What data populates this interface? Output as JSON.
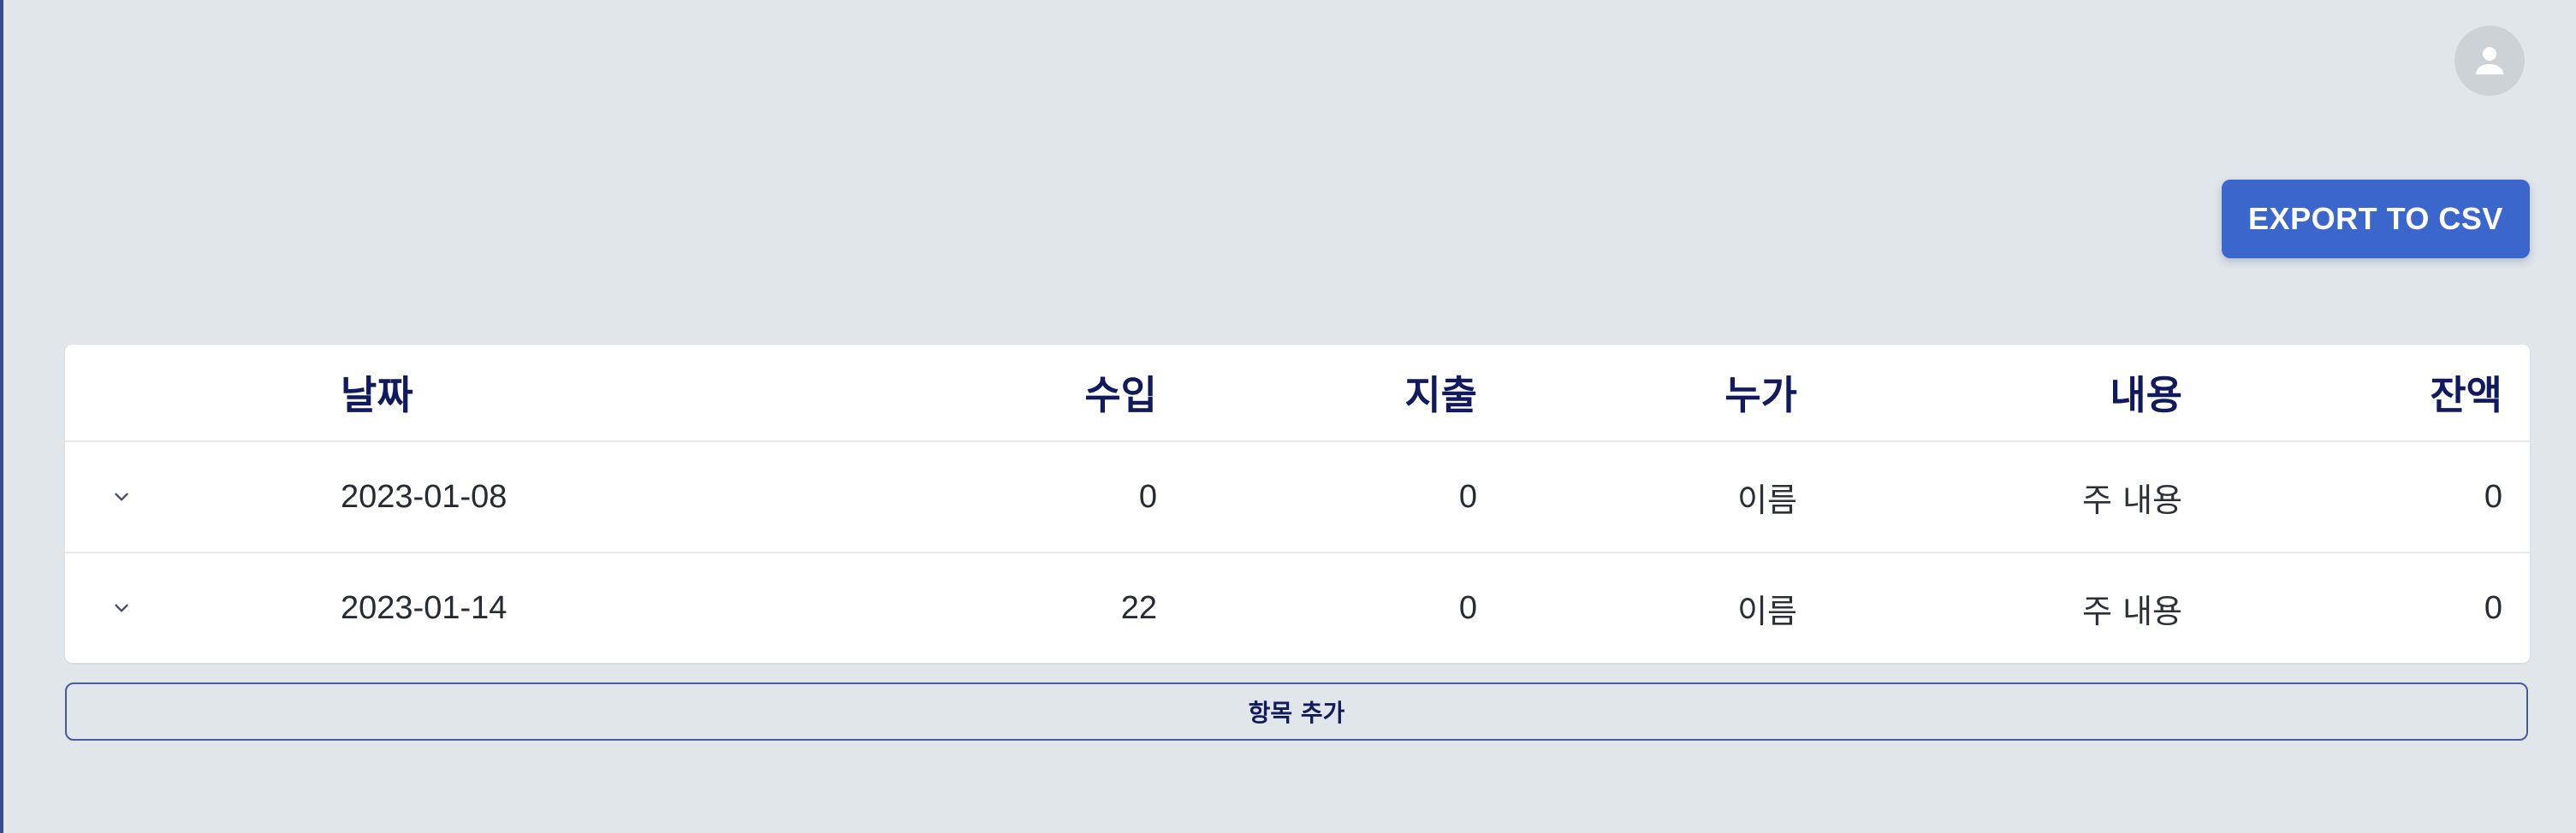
{
  "header": {
    "avatar_icon": "person-icon",
    "export_label": "EXPORT TO CSV",
    "accent_color": "#3b66cc"
  },
  "table": {
    "columns": {
      "date": "날짜",
      "income": "수입",
      "expense": "지출",
      "who": "누가",
      "content": "내용",
      "balance": "잔액"
    },
    "rows": [
      {
        "date": "2023-01-08",
        "income": "0",
        "expense": "0",
        "who": "이름",
        "content": "주 내용",
        "balance": "0"
      },
      {
        "date": "2023-01-14",
        "income": "22",
        "expense": "0",
        "who": "이름",
        "content": "주 내용",
        "balance": "0"
      }
    ],
    "expand_icon": "chevron-down-icon"
  },
  "footer": {
    "add_label": "항목 추가"
  }
}
